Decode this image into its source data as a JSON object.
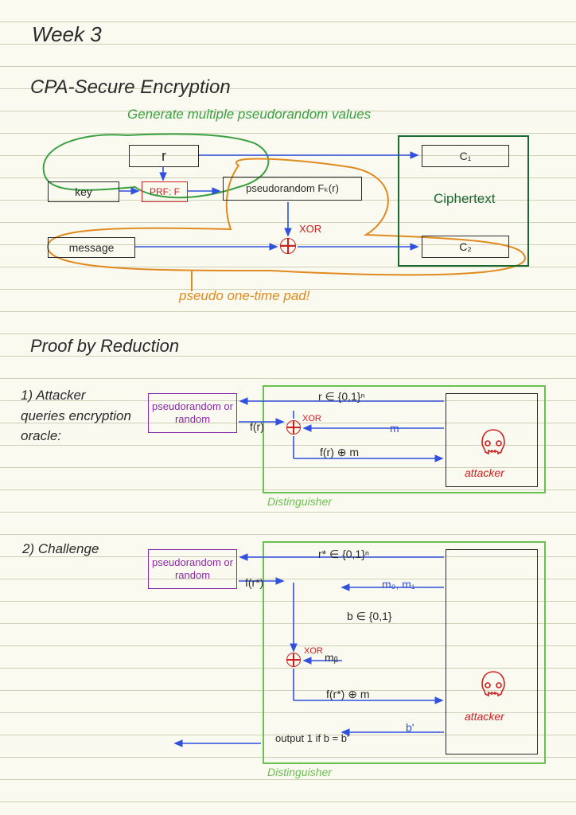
{
  "title": "Week 3",
  "heading1": "CPA-Secure Encryption",
  "annot_generate": "Generate multiple pseudorandom values",
  "box_r": "r",
  "box_key": "key",
  "box_prf": "PRF: F",
  "box_pseudorandom": "pseudorandom Fₖ(r)",
  "box_message": "message",
  "box_c1": "C₁",
  "box_c2": "C₂",
  "label_ciphertext": "Ciphertext",
  "label_xor": "XOR",
  "annot_otp": "pseudo one-time pad!",
  "heading2": "Proof by Reduction",
  "step1": "1) Attacker queries encryption oracle:",
  "step2": "2) Challenge",
  "box_pr_or_random": "pseudorandom or random",
  "label_r_in": "r ∈ {0,1}ⁿ",
  "label_fr": "f(r)",
  "label_m": "m",
  "label_fr_xor_m": "f(r) ⊕ m",
  "label_attacker": "attacker",
  "label_distinguisher": "Distinguisher",
  "label_xor_small": "XOR",
  "label_rstar_in": "r* ∈ {0,1}ⁿ",
  "label_frstar": "f(r*)",
  "label_m0m1": "m₀, m₁",
  "label_b_in": "b ∈ {0,1}",
  "label_mb": "mᵦ",
  "label_frstar_xor_m": "f(r*) ⊕ m",
  "label_bprime": "b'",
  "label_output": "output 1 if b = b'"
}
